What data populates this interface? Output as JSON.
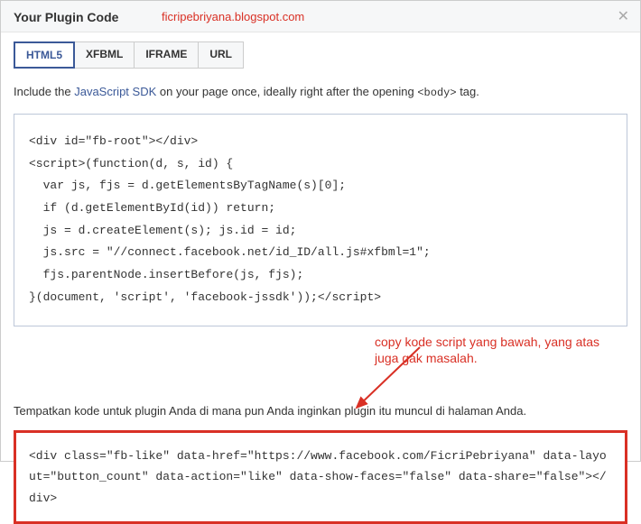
{
  "header": {
    "title": "Your Plugin Code",
    "watermark": "ficripebriyana.blogspot.com"
  },
  "tabs": [
    {
      "label": "HTML5",
      "active": true
    },
    {
      "label": "XFBML",
      "active": false
    },
    {
      "label": "IFRAME",
      "active": false
    },
    {
      "label": "URL",
      "active": false
    }
  ],
  "instruction": {
    "prefix": "Include the ",
    "link": "JavaScript SDK",
    "suffix": " on your page once, ideally right after the opening ",
    "code": "<body>",
    "tail": " tag."
  },
  "code1": "<div id=\"fb-root\"></div>\n<script>(function(d, s, id) {\n  var js, fjs = d.getElementsByTagName(s)[0];\n  if (d.getElementById(id)) return;\n  js = d.createElement(s); js.id = id;\n  js.src = \"//connect.facebook.net/id_ID/all.js#xfbml=1\";\n  fjs.parentNode.insertBefore(js, fjs);\n}(document, 'script', 'facebook-jssdk'));</scr​ipt>",
  "annotation": "copy kode script yang bawah, yang atas juga gak masalah.",
  "instruction2": "Tempatkan kode untuk plugin Anda di mana pun Anda inginkan plugin itu muncul di halaman Anda.",
  "code2": "<div class=\"fb-like\" data-href=\"https://www.facebook.com/FicriPebriyana\" data-layout=\"button_count\" data-action=\"like\" data-show-faces=\"false\" data-share=\"false\"></div>"
}
